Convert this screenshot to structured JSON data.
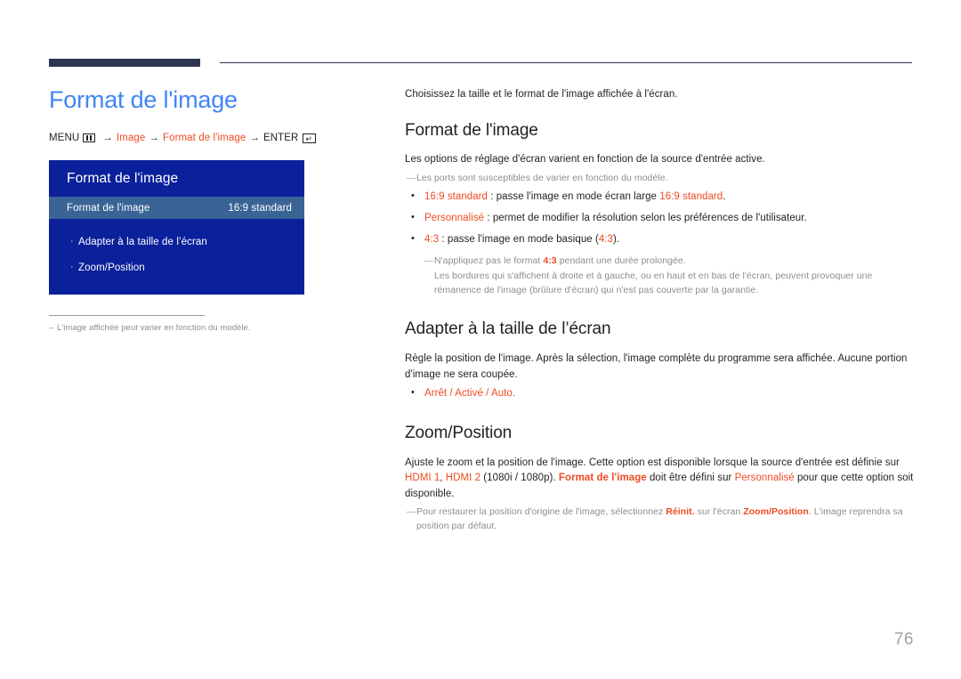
{
  "document": {
    "page_number": "76"
  },
  "left": {
    "title": "Format de l'image",
    "breadcrumb": {
      "menu_label": "MENU",
      "menu_icon": "menu-grid-icon",
      "arrow": "→",
      "crumb1": "Image",
      "crumb2": "Format de l'image",
      "enter_label": "ENTER",
      "enter_icon": "enter-key-icon",
      "enter_glyph": "↵"
    },
    "osd": {
      "header": "Format de l'image",
      "selected_row": {
        "label": "Format de l'image",
        "value": "16:9 standard"
      },
      "items": [
        {
          "marker": "·",
          "label": "Adapter à la taille de l’écran"
        },
        {
          "marker": "·",
          "label": "Zoom/Position"
        }
      ]
    },
    "note": {
      "dash": "–",
      "text": "L'image affichée peut varier en fonction du modèle."
    }
  },
  "right": {
    "intro": "Choisissez la taille et le format de l'image affichée à l'écran.",
    "sections": [
      {
        "heading": "Format de l'image",
        "body": "Les options de réglage d'écran varient en fonction de la source d'entrée active.",
        "note": {
          "dash": "—",
          "text": "Les ports sont susceptibles de varier en fonction du modèle."
        },
        "bullets": [
          {
            "term": "16:9 standard",
            "rest_before": " : passe l'image en mode écran large ",
            "term2": "16:9 standard",
            "rest_after": "."
          },
          {
            "term": "Personnalisé",
            "rest_before": " : permet de modifier la résolution selon les préférences de l'utilisateur.",
            "term2": "",
            "rest_after": ""
          },
          {
            "term": "4:3",
            "rest_before": " : passe l'image en mode basique (",
            "term2": "4:3",
            "rest_after": ")."
          }
        ],
        "subnote": {
          "dash": "—",
          "line1_a": "N'appliquez pas le format ",
          "line1_term": "4:3",
          "line1_b": " pendant une durée prolongée.",
          "line2": "Les bordures qui s'affichent à droite et à gauche, ou en haut et en bas de l'écran, peuvent provoquer une rémanence de l'image (brûlure d'écran) qui n'est pas couverte par la garantie."
        }
      },
      {
        "heading": "Adapter à la taille de l’écran",
        "body": "Règle la position de l'image. Après la sélection, l'image complète du programme sera affichée. Aucune portion d'image ne sera coupée.",
        "options": "Arrêt / Activé / Auto."
      },
      {
        "heading": "Zoom/Position",
        "body_a": "Ajuste le zoom et la position de l'image. Cette option est disponible lorsque la source d'entrée est définie sur ",
        "term_hdmi1": "HDMI 1",
        "body_b": ", ",
        "term_hdmi2": "HDMI 2",
        "body_c": " (1080i / 1080p). ",
        "term_format": "Format de l'image",
        "body_d": " doit être défini sur ",
        "term_perso": "Personnalisé",
        "body_e": " pour que cette option soit disponible.",
        "subnote": {
          "dash": "—",
          "a": "Pour restaurer la position d'origine de l'image, sélectionnez ",
          "term1": "Réinit.",
          "b": " sur l'écran ",
          "term2": "Zoom/Position",
          "c": ". L'image reprendra sa position par défaut."
        }
      }
    ]
  },
  "colors": {
    "title_blue": "#4285f4",
    "osd_blue": "#0b209b",
    "osd_row_blue": "#3a6496",
    "accent_orange": "#ee4b23",
    "rule_navy": "#2e3553",
    "muted_gray": "#8d8d8d"
  }
}
